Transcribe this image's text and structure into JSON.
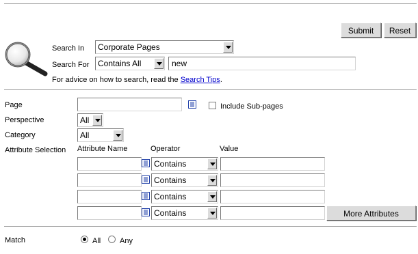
{
  "buttons": {
    "submit": "Submit",
    "reset": "Reset",
    "more_attributes": "More Attributes"
  },
  "search": {
    "search_in_label": "Search In",
    "search_in_value": "Corporate Pages",
    "search_for_label": "Search For",
    "search_for_mode": "Contains All",
    "search_for_value": "new",
    "advice_text": "For advice on how to search, read the ",
    "advice_link": "Search Tips",
    "advice_end": "."
  },
  "filters": {
    "page_label": "Page",
    "page_value": "",
    "include_subpages_label": "Include Sub-pages",
    "perspective_label": "Perspective",
    "perspective_value": "All",
    "category_label": "Category",
    "category_value": "All",
    "attribute_selection_label": "Attribute Selection"
  },
  "attributes": {
    "headers": {
      "name": "Attribute Name",
      "operator": "Operator",
      "value": "Value"
    },
    "rows": [
      {
        "name": "",
        "operator": "Contains",
        "value": ""
      },
      {
        "name": "",
        "operator": "Contains",
        "value": ""
      },
      {
        "name": "",
        "operator": "Contains",
        "value": ""
      },
      {
        "name": "",
        "operator": "Contains",
        "value": ""
      }
    ]
  },
  "match": {
    "label": "Match",
    "options": [
      "All",
      "Any"
    ],
    "selected": "All"
  },
  "icons": {
    "search": "magnifier-icon",
    "picker": "list-picker-icon"
  }
}
